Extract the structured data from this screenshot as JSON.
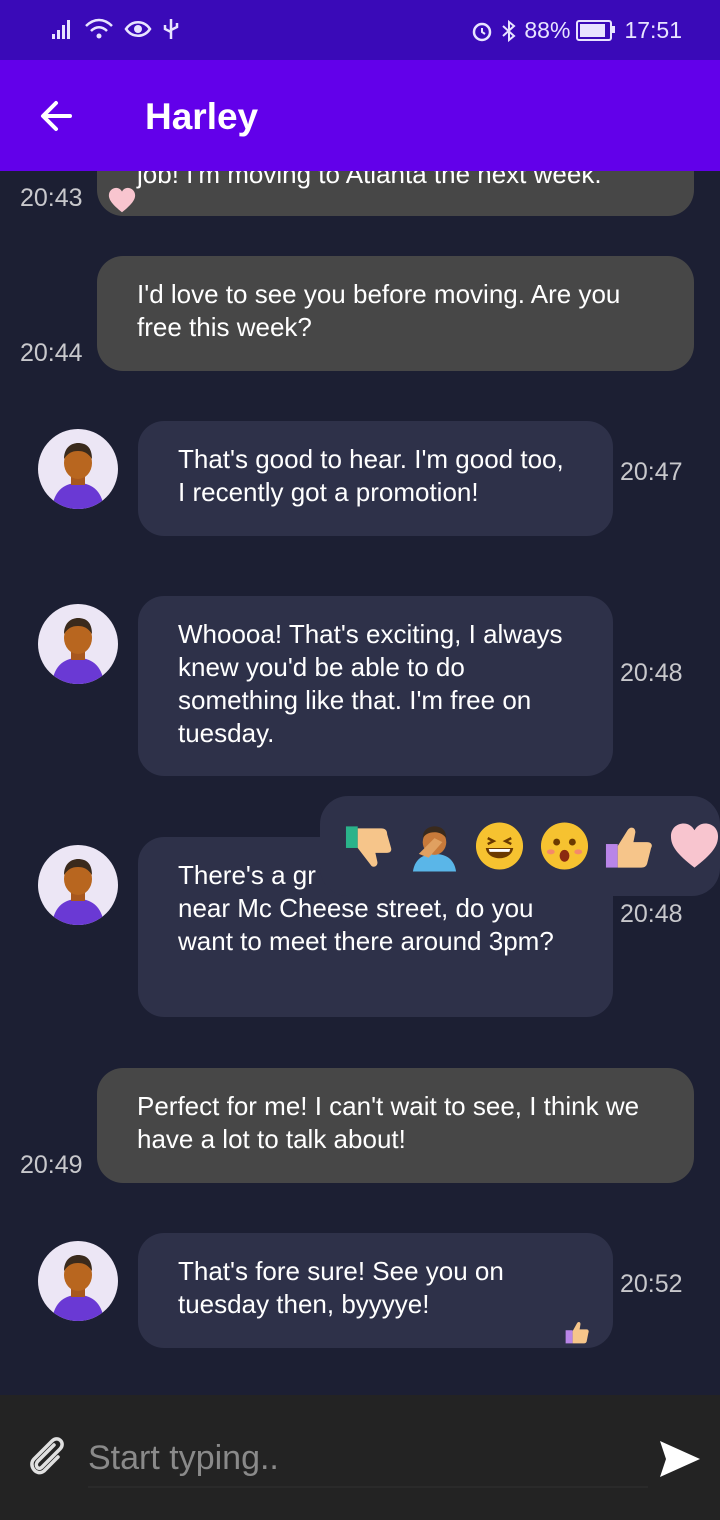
{
  "status_bar": {
    "battery": "88%",
    "time": "17:51",
    "battery_level": 0.88
  },
  "header": {
    "title": "Harley",
    "back_icon": "arrow-left-icon"
  },
  "messages": [
    {
      "side": "out",
      "text": "job! I'm moving to Atlanta the next week.",
      "time": "20:43",
      "reaction": "heart-icon"
    },
    {
      "side": "out",
      "text": "I'd love to see you before moving. Are you free this week?",
      "time": "20:44"
    },
    {
      "side": "in",
      "text": "That's good to hear. I'm good too, I recently got a promotion!",
      "time": "20:47"
    },
    {
      "side": "in",
      "text": "Whoooa! That's exciting, I always knew you'd be able to do something like that. I'm free on tuesday.",
      "time": "20:48"
    },
    {
      "side": "in",
      "text": "There's a gr that recently opened near Mc Cheese street, do you want to meet there around 3pm?",
      "time": "20:48"
    },
    {
      "side": "out",
      "text": "Perfect for me! I can't wait to see, I think we have a lot to talk about!",
      "time": "20:49"
    },
    {
      "side": "in",
      "text": "That's fore sure! See you on tuesday then, byyyye!",
      "time": "20:52",
      "reaction": "thumbs-up-icon"
    }
  ],
  "reaction_picker": [
    "thumbs-down-icon",
    "facepalm-icon",
    "grinning-squint-icon",
    "surprised-face-icon",
    "thumbs-up-icon",
    "heart-icon"
  ],
  "composer": {
    "placeholder": "Start typing..",
    "value": ""
  },
  "colors": {
    "status_bar": "#3a0ab8",
    "app_bar": "#6200ea",
    "background": "#1c1f33",
    "outgoing_bubble": "#474747",
    "incoming_bubble": "#2e3149",
    "input_bar": "#232323"
  }
}
